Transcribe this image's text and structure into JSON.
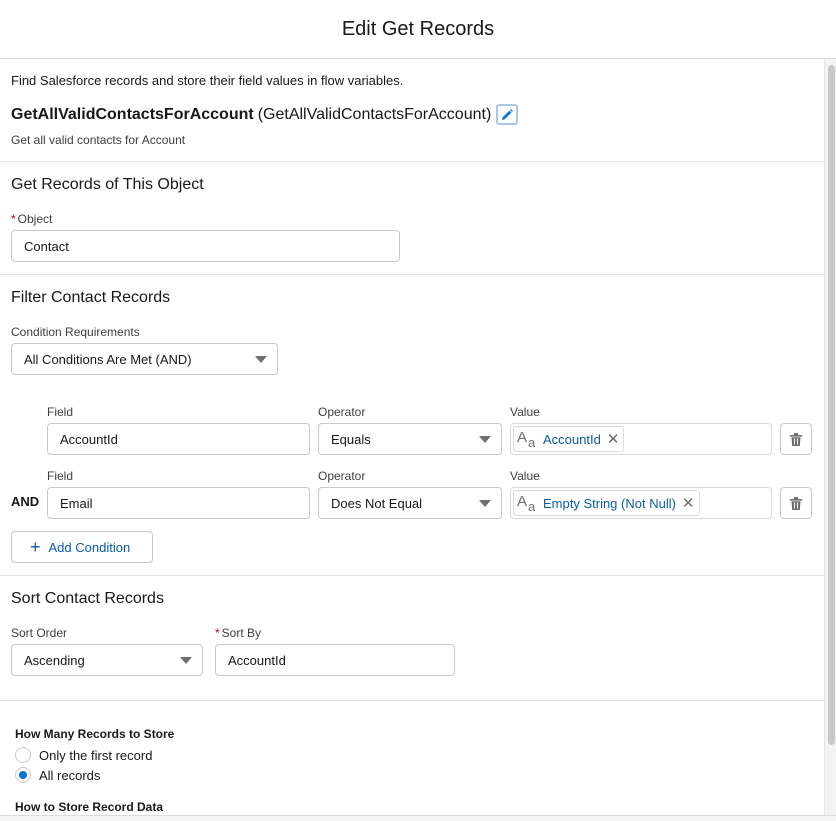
{
  "modal": {
    "title": "Edit Get Records"
  },
  "element": {
    "description_text": "Find Salesforce records and store their field values in flow variables.",
    "label": "GetAllValidContactsForAccount",
    "api_name": "(GetAllValidContactsForAccount)",
    "description": "Get all valid contacts for Account"
  },
  "object_section": {
    "title": "Get Records of This Object",
    "required_mark": "*",
    "object_label": "Object",
    "object_value": "Contact"
  },
  "filter_section": {
    "title": "Filter Contact Records",
    "requirement_label": "Condition Requirements",
    "requirement_value": "All Conditions Are Met (AND)",
    "conditions": [
      {
        "logic": "",
        "field_label": "Field",
        "field_value": "AccountId",
        "operator_label": "Operator",
        "operator_value": "Equals",
        "value_label": "Value",
        "value_pill": "AccountId"
      },
      {
        "logic": "AND",
        "field_label": "Field",
        "field_value": "Email",
        "operator_label": "Operator",
        "operator_value": "Does Not Equal",
        "value_label": "Value",
        "value_pill": "Empty String (Not Null)"
      }
    ],
    "add_condition_label": "Add Condition"
  },
  "sort_section": {
    "title": "Sort Contact Records",
    "order_label": "Sort Order",
    "order_value": "Ascending",
    "required_mark": "*",
    "sort_by_label": "Sort By",
    "sort_by_value": "AccountId"
  },
  "store_section": {
    "how_many_label": "How Many Records to Store",
    "options": [
      {
        "label": "Only the first record",
        "selected": false
      },
      {
        "label": "All records",
        "selected": true
      }
    ],
    "how_to_store_label": "How to Store Record Data"
  },
  "icons": {
    "edit": "pencil-icon",
    "text_type": "text-type-icon",
    "remove": "close-icon",
    "delete": "trash-icon",
    "add": "plus-icon",
    "dropdown": "chevron-down-icon"
  },
  "colors": {
    "link": "#0b5cab",
    "required": "#ba0517",
    "radio_selected": "#0176d3"
  }
}
